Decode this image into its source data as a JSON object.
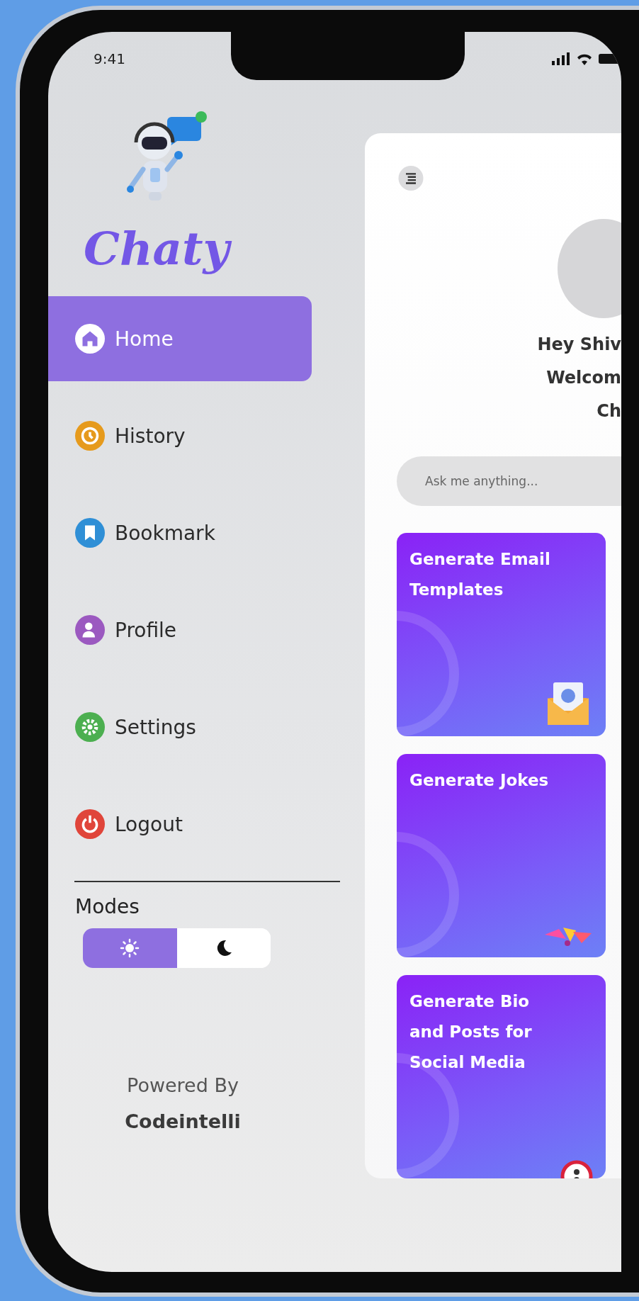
{
  "status_bar": {
    "time": "9:41"
  },
  "sidebar": {
    "app_name": "Chaty",
    "items": [
      {
        "label": "Home",
        "kind": "home",
        "color": "#ffffff",
        "selected": true
      },
      {
        "label": "History",
        "kind": "history",
        "color": "#e69a1c",
        "selected": false
      },
      {
        "label": "Bookmark",
        "kind": "bookmark",
        "color": "#2f8fd6",
        "selected": false
      },
      {
        "label": "Profile",
        "kind": "profile",
        "color": "#9b59c0",
        "selected": false
      },
      {
        "label": "Settings",
        "kind": "settings",
        "color": "#4caf50",
        "selected": false
      },
      {
        "label": "Logout",
        "kind": "logout",
        "color": "#e0453a",
        "selected": false
      }
    ],
    "modes": {
      "label": "Modes",
      "options": [
        {
          "kind": "light",
          "selected": true
        },
        {
          "kind": "dark",
          "selected": false
        }
      ]
    },
    "footer": {
      "caption": "Powered By",
      "brand": "Codeintelli"
    }
  },
  "main": {
    "greeting": [
      "Hey Shiv",
      "Welcom",
      "Ch"
    ],
    "search": {
      "placeholder": "Ask me anything..."
    },
    "cards": [
      {
        "title": "Generate Email Templates",
        "kind": "email"
      },
      {
        "title": "Generate Jokes",
        "kind": "jokes"
      },
      {
        "title": "Generate Bio and Posts for Social Media",
        "kind": "bio"
      }
    ]
  }
}
